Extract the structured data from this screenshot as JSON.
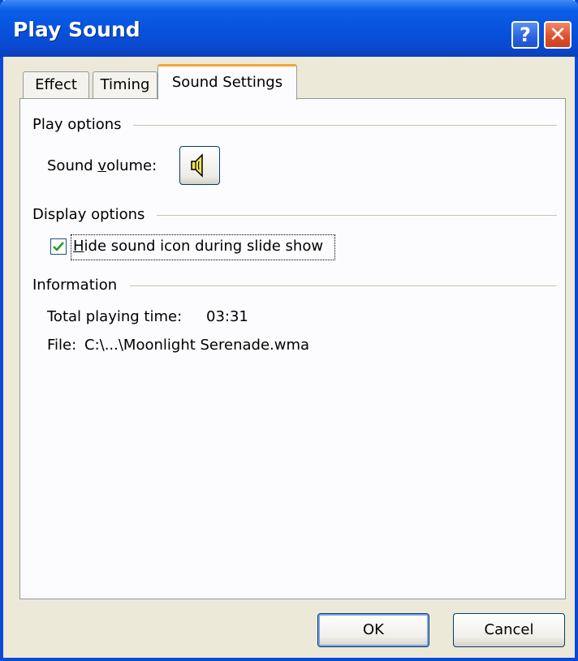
{
  "window": {
    "title": "Play Sound",
    "help_label": "?",
    "close_label": "✕"
  },
  "tabs": [
    {
      "label": "Effect",
      "active": false
    },
    {
      "label": "Timing",
      "active": false
    },
    {
      "label": "Sound Settings",
      "active": true
    }
  ],
  "play_options": {
    "group_label": "Play options",
    "volume_label_pre": "Sound ",
    "volume_label_accel": "v",
    "volume_label_post": "olume:",
    "volume_icon": "speaker-icon"
  },
  "display_options": {
    "group_label": "Display options",
    "hide_icon_accel": "H",
    "hide_icon_label_rest": "ide sound icon during slide show",
    "hide_icon_checked": true
  },
  "information": {
    "group_label": "Information",
    "total_time_label": "Total playing time:",
    "total_time_value": "03:31",
    "file_label": "File:",
    "file_value": "C:\\...\\Moonlight Serenade.wma"
  },
  "buttons": {
    "ok_label": "OK",
    "cancel_label": "Cancel"
  },
  "colors": {
    "titlebar": "#0752dc",
    "dialog_bg": "#ece9d8",
    "active_tab_accent": "#f4a43a",
    "check": "#21a121"
  }
}
